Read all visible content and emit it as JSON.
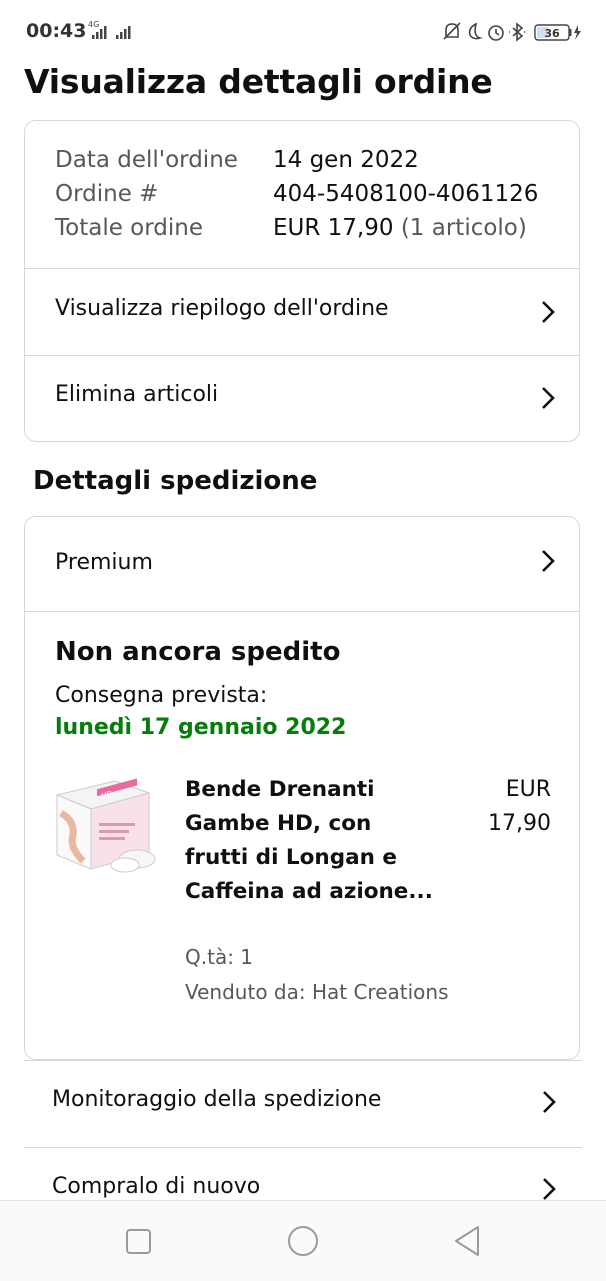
{
  "status_bar": {
    "time": "00:43",
    "network": "4G",
    "battery": "36",
    "icons": [
      "signal-icon",
      "mute-bell-icon",
      "moon-icon",
      "alarm-icon",
      "bluetooth-icon",
      "battery-icon",
      "charging-icon"
    ]
  },
  "page": {
    "title": "Visualizza dettagli ordine"
  },
  "order": {
    "date_label": "Data dell'ordine",
    "date_value": "14 gen 2022",
    "number_label": "Ordine #",
    "number_value": "404-5408100-4061126",
    "total_label": "Totale ordine",
    "total_value": "EUR 17,90",
    "total_items": "(1 articolo)",
    "summary_link": "Visualizza riepilogo dell'ordine",
    "delete_link": "Elimina articoli"
  },
  "shipment": {
    "section_title": "Dettagli spedizione",
    "shipping_type": "Premium",
    "status": "Non ancora spedito",
    "delivery_label": "Consegna prevista:",
    "delivery_date": "lunedì 17 gennaio 2022",
    "item": {
      "title": "Bende Drenanti Gambe HD, con frutti di Longan e Caffeina ad azione...",
      "price_currency": "EUR",
      "price_amount": "17,90",
      "quantity": "Q.tà: 1",
      "seller": "Venduto da: Hat Creations"
    }
  },
  "actions": {
    "track": "Monitoraggio della spedizione",
    "buy_again": "Compralo di nuovo"
  },
  "colors": {
    "delivery_green": "#067d0a",
    "border": "#d5d9d9",
    "text": "#0f1111",
    "muted": "#565959"
  }
}
